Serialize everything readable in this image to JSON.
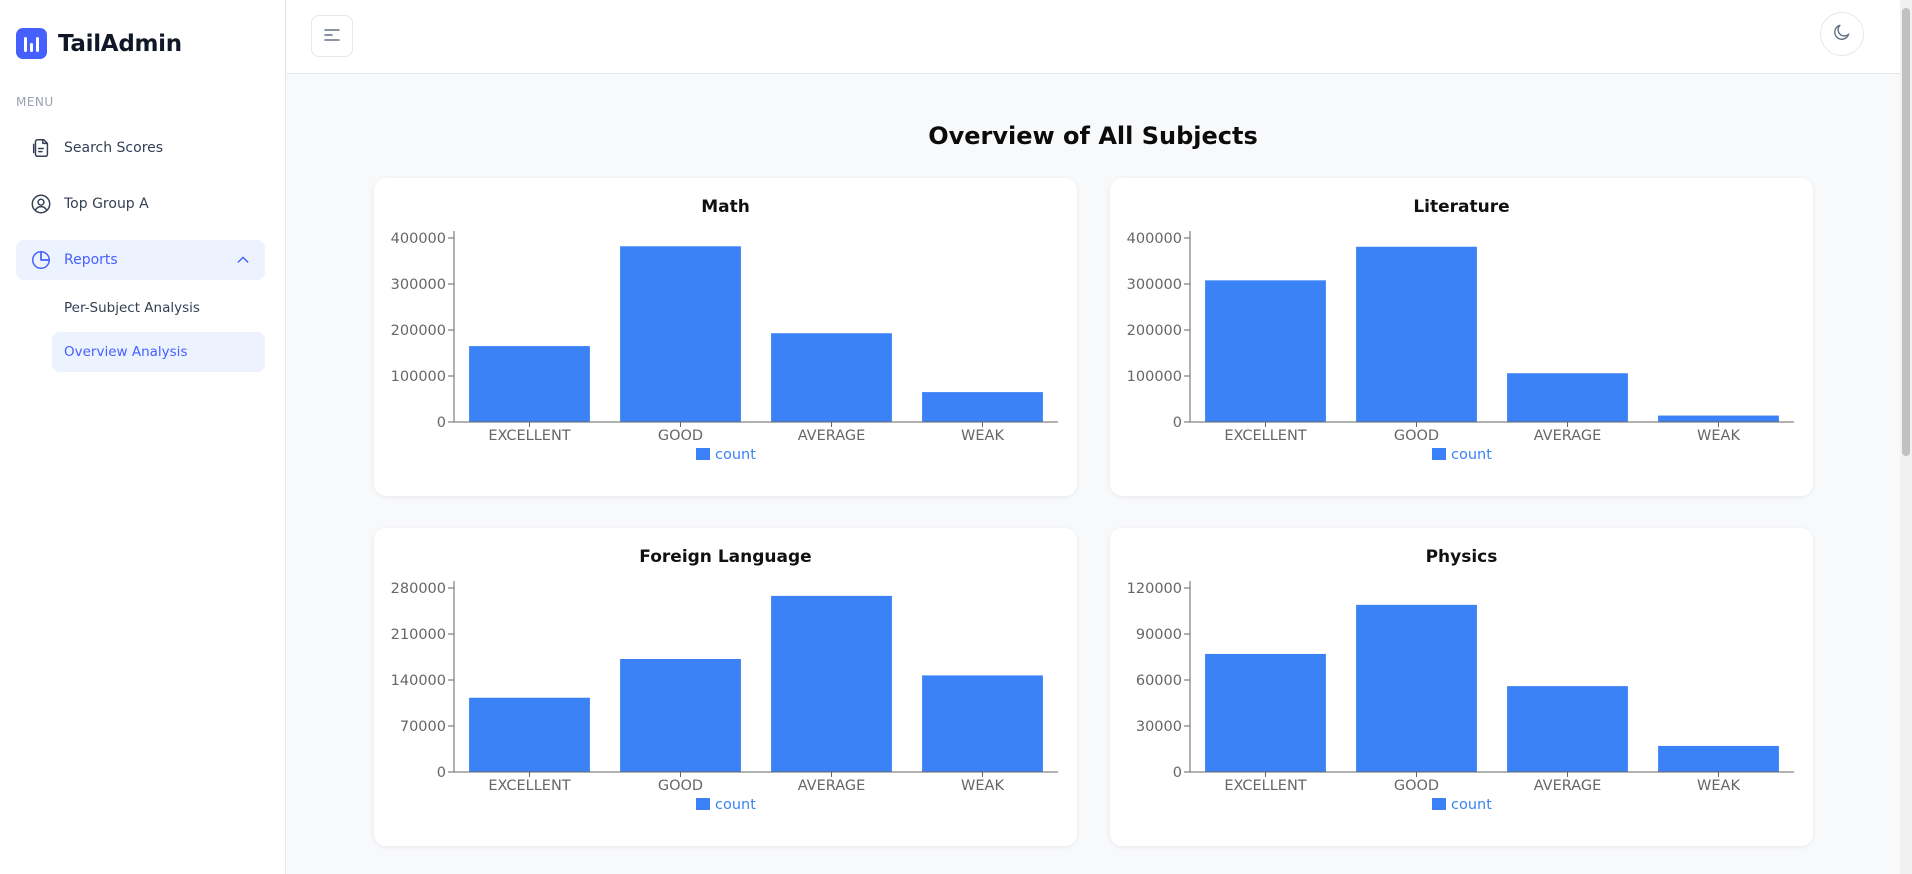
{
  "brand": {
    "name": "TailAdmin"
  },
  "sidebar": {
    "menu_label": "MENU",
    "items": [
      {
        "label": "Search Scores",
        "icon": "document-icon"
      },
      {
        "label": "Top Group A",
        "icon": "user-circle-icon"
      },
      {
        "label": "Reports",
        "icon": "pie-chart-icon",
        "expanded": true
      }
    ],
    "sub_items": [
      {
        "label": "Per-Subject Analysis"
      },
      {
        "label": "Overview Analysis",
        "active": true
      }
    ]
  },
  "header": {
    "menu_icon": "hamburger-icon",
    "theme_icon": "moon-icon"
  },
  "main": {
    "title": "Overview of All Subjects"
  },
  "colors": {
    "accent": "#465fff",
    "bar": "#3b82f6",
    "active_bg": "#ecf3ff"
  },
  "chart_data": [
    {
      "type": "bar",
      "title": "Math",
      "categories": [
        "EXCELLENT",
        "GOOD",
        "AVERAGE",
        "WEAK"
      ],
      "series": [
        {
          "name": "count",
          "values": [
            165000,
            382000,
            193000,
            65000
          ]
        }
      ],
      "ticks": [
        0,
        100000,
        200000,
        300000,
        400000
      ],
      "tick_labels": [
        "0",
        "100000",
        "200000",
        "300000",
        "400000"
      ],
      "ylim": [
        0,
        400000
      ],
      "legend": "bottom"
    },
    {
      "type": "bar",
      "title": "Literature",
      "categories": [
        "EXCELLENT",
        "GOOD",
        "AVERAGE",
        "WEAK"
      ],
      "series": [
        {
          "name": "count",
          "values": [
            308000,
            381000,
            106000,
            14000
          ]
        }
      ],
      "ticks": [
        0,
        100000,
        200000,
        300000,
        400000
      ],
      "tick_labels": [
        "0",
        "100000",
        "200000",
        "300000",
        "400000"
      ],
      "ylim": [
        0,
        400000
      ],
      "legend": "bottom"
    },
    {
      "type": "bar",
      "title": "Foreign Language",
      "categories": [
        "EXCELLENT",
        "GOOD",
        "AVERAGE",
        "WEAK"
      ],
      "series": [
        {
          "name": "count",
          "values": [
            113000,
            172000,
            268000,
            147000
          ]
        }
      ],
      "ticks": [
        0,
        70000,
        140000,
        210000,
        280000
      ],
      "tick_labels": [
        "0",
        "70000",
        "140000",
        "210000",
        "280000"
      ],
      "ylim": [
        0,
        280000
      ],
      "legend": "bottom"
    },
    {
      "type": "bar",
      "title": "Physics",
      "categories": [
        "EXCELLENT",
        "GOOD",
        "AVERAGE",
        "WEAK"
      ],
      "series": [
        {
          "name": "count",
          "values": [
            77000,
            109000,
            56000,
            17000
          ]
        }
      ],
      "ticks": [
        0,
        30000,
        60000,
        90000,
        120000
      ],
      "tick_labels": [
        "0",
        "30000",
        "60000",
        "90000",
        "120000"
      ],
      "ylim": [
        0,
        120000
      ],
      "legend": "bottom"
    }
  ]
}
